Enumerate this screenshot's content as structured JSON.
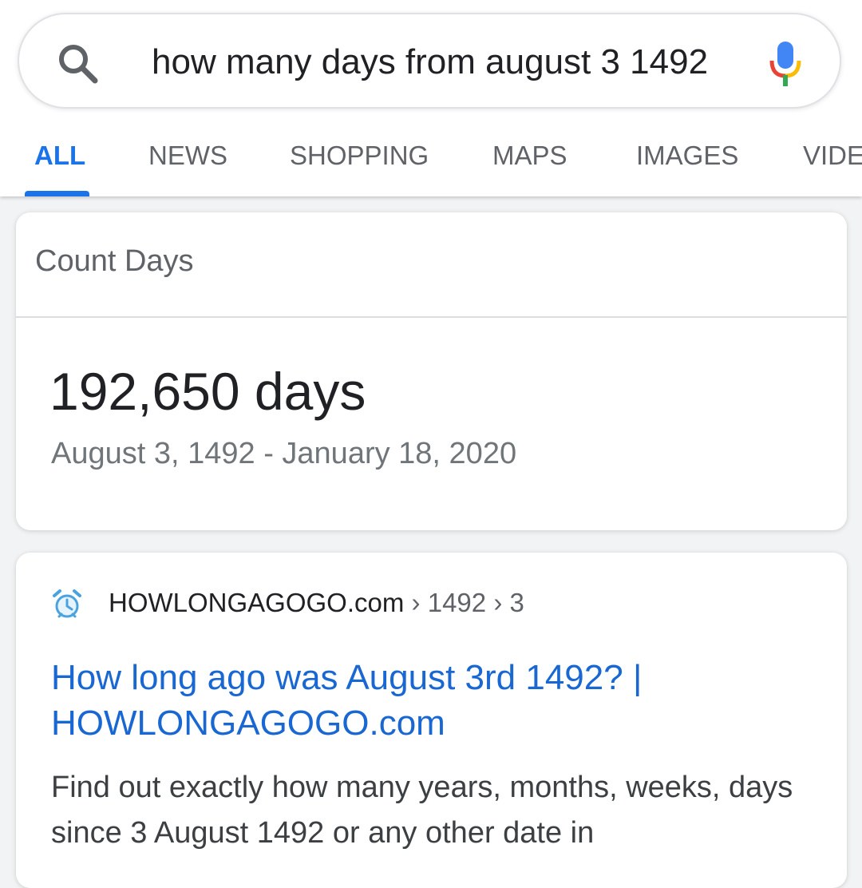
{
  "search": {
    "query": "how many days from august 3 1492"
  },
  "tabs": [
    {
      "label": "ALL",
      "active": true
    },
    {
      "label": "NEWS",
      "active": false
    },
    {
      "label": "SHOPPING",
      "active": false
    },
    {
      "label": "MAPS",
      "active": false
    },
    {
      "label": "IMAGES",
      "active": false
    },
    {
      "label": "VIDEOS",
      "active": false
    }
  ],
  "count_card": {
    "title": "Count Days",
    "value": "192,650 days",
    "range": "August 3, 1492 - January 18, 2020"
  },
  "result": {
    "site": "HOWLONGAGOGO.com",
    "crumb_sep": "›",
    "crumbs": [
      "1492",
      "3"
    ],
    "title": "How long ago was August 3rd 1492? | HOWLONGAGOGO.com",
    "snippet": "Find out exactly how many years, months, weeks, days since 3 August 1492 or any other date in"
  },
  "colors": {
    "accent": "#1a73e8",
    "link": "#1967d2",
    "muted": "#5f6368"
  }
}
